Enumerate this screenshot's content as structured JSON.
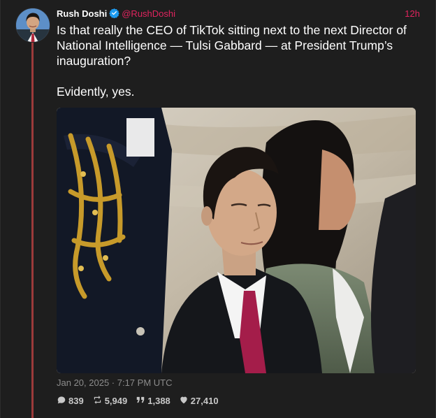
{
  "author": {
    "name": "Rush Doshi",
    "handle": "@RushDoshi",
    "verified": true
  },
  "tweet": {
    "time_ago": "12h",
    "text_lines": [
      "Is that really the CEO of TikTok sitting next to the next Director of National Intelligence — Tulsi Gabbard — at President Trump’s inauguration?",
      "Evidently, yes."
    ],
    "timestamp": "Jan 20, 2025 · 7:17 PM UTC"
  },
  "stats": {
    "replies": "839",
    "retweets": "5,949",
    "quotes": "1,388",
    "likes": "27,410"
  },
  "icons": {
    "verified": "verified-badge-icon",
    "reply": "comment-icon",
    "retweet": "retweet-icon",
    "quote": "quote-icon",
    "like": "heart-icon"
  },
  "colors": {
    "background": "#1e1e1e",
    "accent": "#e0245e",
    "thread_line": "#9b3a3a",
    "verified": "#1d9bf0",
    "muted": "#8c8c8c"
  }
}
